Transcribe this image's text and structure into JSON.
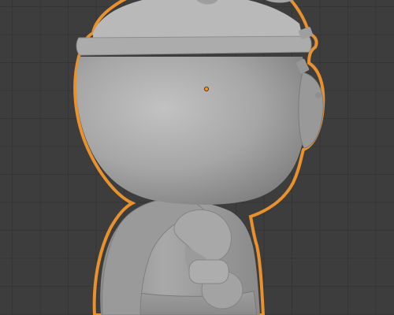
{
  "viewport": {
    "mode": "Object Mode",
    "shading": "solid",
    "grid": true,
    "selection_outline_color": "#e8912d",
    "origin_color": "#ff8c1a",
    "background_color": "#3d3d3d",
    "grid_color": "#353535",
    "mesh_color": "#a9a9a9"
  },
  "selected_object": {
    "type": "mesh",
    "selected": true,
    "active": true
  }
}
